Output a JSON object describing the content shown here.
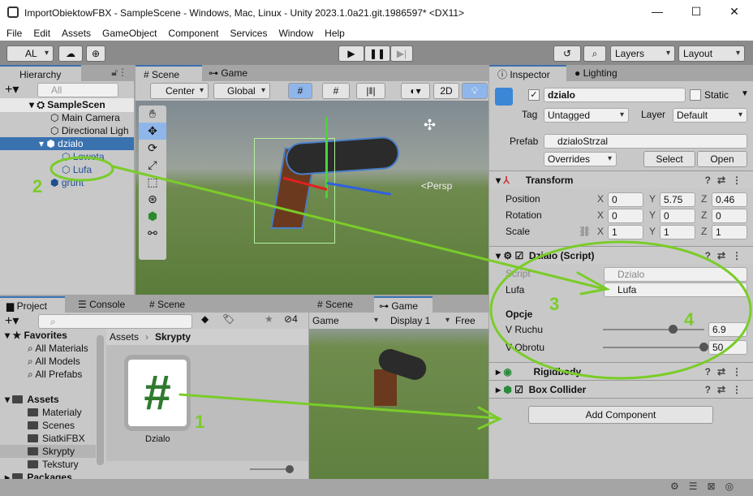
{
  "window": {
    "title": "ImportObiektowFBX - SampleScene - Windows, Mac, Linux - Unity 2023.1.0a21.git.1986597* <DX11>"
  },
  "menu": [
    "File",
    "Edit",
    "Assets",
    "GameObject",
    "Component",
    "Services",
    "Window",
    "Help"
  ],
  "toolbar": {
    "account": "AL",
    "layers": "Layers",
    "layout": "Layout"
  },
  "hierarchy": {
    "tab": "Hierarchy",
    "search_placeholder": "All",
    "scene": "SampleScen",
    "items": [
      "Main Camera",
      "Directional Ligh",
      "dzialo",
      "Loweta",
      "Lufa",
      "grunt"
    ]
  },
  "scene": {
    "tab_scene": "Scene",
    "tab_game": "Game",
    "pivot": "Center",
    "space": "Global",
    "mode2d": "2D",
    "persp": "<Persp"
  },
  "inspector": {
    "tab": "Inspector",
    "tab_lighting": "Lighting",
    "name": "dzialo",
    "static": "Static",
    "tag_label": "Tag",
    "tag": "Untagged",
    "layer_label": "Layer",
    "layer": "Default",
    "prefab_label": "Prefab",
    "prefab": "dzialoStrzal",
    "overrides": "Overrides",
    "select": "Select",
    "open": "Open",
    "transform": {
      "title": "Transform",
      "rows": [
        {
          "label": "Position",
          "x": "0",
          "y": "5.75",
          "z": "0.46"
        },
        {
          "label": "Rotation",
          "x": "0",
          "y": "0",
          "z": "0"
        },
        {
          "label": "Scale",
          "x": "1",
          "y": "1",
          "z": "1"
        }
      ]
    },
    "script": {
      "title": "Dzialo (Script)",
      "script_label": "Script",
      "script": "Dzialo",
      "lufa_label": "Lufa",
      "lufa": "Lufa",
      "section": "Opcje",
      "v_ruchu_label": "V Ruchu",
      "v_ruchu": "6.9",
      "v_ruchu_fraction": 0.68,
      "v_obrotu_label": "V Obrotu",
      "v_obrotu": "50",
      "v_obrotu_fraction": 1.0
    },
    "rigidbody": "Rigidbody",
    "box_collider": "Box Collider",
    "add_component": "Add Component"
  },
  "project": {
    "tab": "Project",
    "tab_console": "Console",
    "tab_scene": "Scene",
    "hidden_count": "4",
    "favorites": "Favorites",
    "fav_items": [
      "All Materials",
      "All Models",
      "All Prefabs"
    ],
    "assets": "Assets",
    "folders": [
      "Materialy",
      "Scenes",
      "SiatkiFBX",
      "Skrypty",
      "Tekstury"
    ],
    "packages": "Packages",
    "breadcrumb_root": "Assets",
    "breadcrumb_current": "Skrypty",
    "asset_name": "Dzialo"
  },
  "game": {
    "tab_scene": "Scene",
    "tab_game": "Game",
    "view": "Game",
    "display": "Display 1",
    "aspect": "Free As"
  },
  "annotations": [
    "1",
    "2",
    "3",
    "4"
  ],
  "colors": {
    "accent": "#3a72b0",
    "annotation": "#7acc29",
    "selection": "#3a72b0"
  }
}
